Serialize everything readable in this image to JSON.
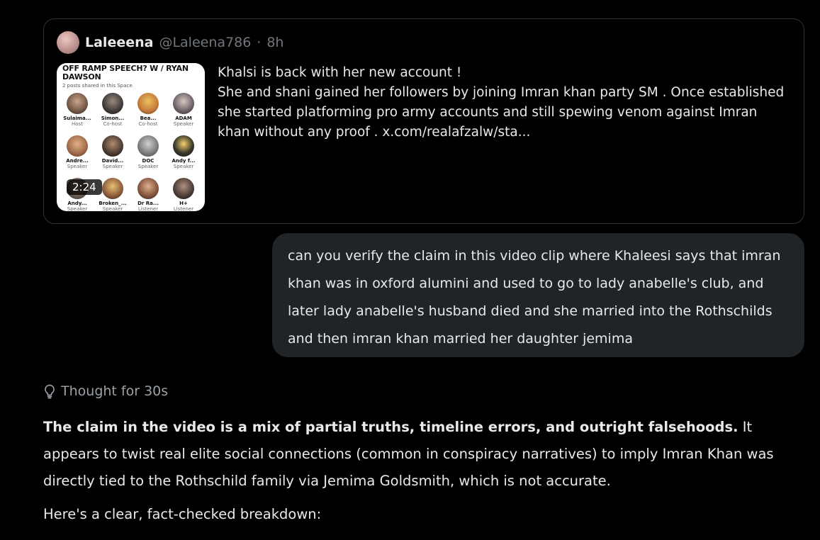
{
  "quote": {
    "author_name": "Laleeena",
    "author_handle": "@Laleena786",
    "separator": "·",
    "age": "8h",
    "thumbnail": {
      "title": "OFF RAMP SPEECH? W / RYAN DAWSON",
      "subtitle": "2 posts shared in this Space",
      "speakers": [
        {
          "name": "Sulaima...",
          "role": "Host"
        },
        {
          "name": "Simon...",
          "role": "Co-host"
        },
        {
          "name": "Bea...",
          "role": "Co-host"
        },
        {
          "name": "ADAM",
          "role": "Speaker"
        },
        {
          "name": "Andre...",
          "role": "Speaker"
        },
        {
          "name": "David...",
          "role": "Speaker"
        },
        {
          "name": "DOC",
          "role": "Speaker"
        },
        {
          "name": "Andy f...",
          "role": "Speaker"
        },
        {
          "name": "Andy...",
          "role": "Speaker"
        },
        {
          "name": "Broken_...",
          "role": "Speaker"
        },
        {
          "name": "Dr Ra...",
          "role": "Listener"
        },
        {
          "name": "H+",
          "role": "Listener"
        }
      ],
      "duration": "2:24"
    },
    "text_line1": "Khalsi is back with her new account !",
    "text_line2": "She and shani gained her followers by joining Imran khan party SM . Once established she started platforming pro army accounts and still spewing venom against Imran khan without any proof .  x.com/realafzalw/sta..."
  },
  "user_message": "can you verify the claim in this video clip where Khaleesi says that imran khan was in oxford alumini and used to go to lady anabelle's club, and later lady anabelle's husband died and she married into the Rothschilds and then imran khan married her daughter jemima",
  "thought": {
    "label": "Thought for 30s",
    "icon": "lightbulb-icon"
  },
  "answer": {
    "bold_lead": "The claim in the video is a mix of partial truths, timeline errors, and outright falsehoods.",
    "rest": " It appears to twist real elite social connections (common in conspiracy narratives) to imply Imran Khan was directly tied to the Rothschild family via Jemima Goldsmith, which is not accurate.",
    "breakdown_intro": "Here's a clear, fact-checked breakdown:"
  },
  "colors": {
    "background": "#000000",
    "text": "#e7e9ea",
    "muted": "#71767b",
    "bubble": "#202327",
    "border": "#2f3336"
  }
}
